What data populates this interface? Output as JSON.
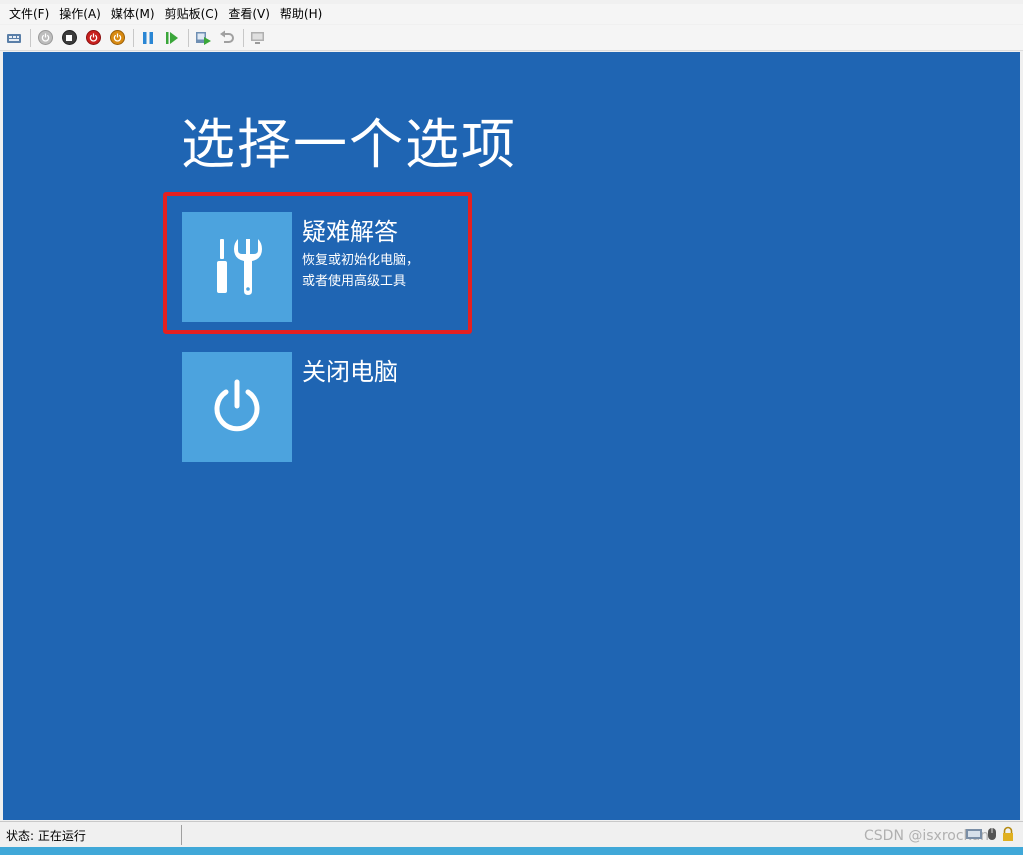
{
  "menu": {
    "items": [
      "文件(F)",
      "操作(A)",
      "媒体(M)",
      "剪贴板(C)",
      "查看(V)",
      "帮助(H)"
    ]
  },
  "toolbar": {
    "buttons": [
      "ctrl-alt-del-icon",
      "start-icon",
      "turn-off-icon",
      "shut-down-icon",
      "save-icon",
      "pause-icon",
      "resume-icon",
      "checkpoint-icon",
      "revert-icon",
      "enhanced-session-icon"
    ]
  },
  "screen": {
    "title": "选择一个选项",
    "options": [
      {
        "title": "疑难解答",
        "description_line1": "恢复或初始化电脑，",
        "description_line2": "或者使用高级工具",
        "icon": "tools-icon"
      },
      {
        "title": "关闭电脑",
        "icon": "power-icon"
      }
    ]
  },
  "status": {
    "text": "状态: 正在运行",
    "watermark": "CSDN @isxrockun"
  },
  "colors": {
    "screen_bg": "#1f65b3",
    "tile_bg": "#4ca3de",
    "highlight": "#e52020"
  }
}
